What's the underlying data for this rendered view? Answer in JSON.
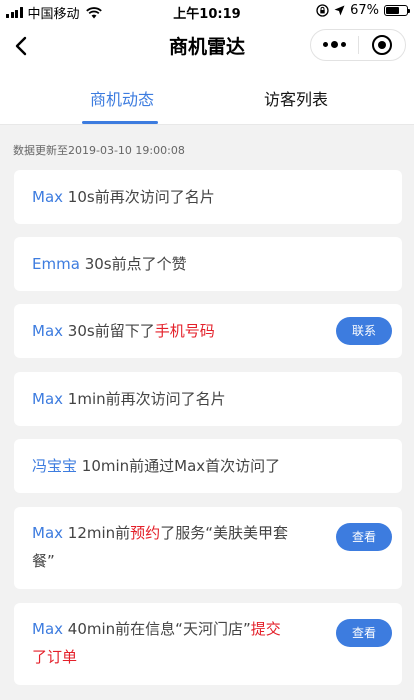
{
  "status_bar": {
    "carrier": "中国移动",
    "time": "上午10:19",
    "battery": "67%",
    "battery_level": 0.67,
    "icons": [
      "signal-icon",
      "wifi-icon",
      "lock-rotation-icon",
      "location-icon",
      "battery-icon"
    ]
  },
  "nav": {
    "title": "商机雷达",
    "back_icon": "chevron-left-icon",
    "more_icon": "more-dots-icon",
    "close_icon": "target-icon"
  },
  "tabs": [
    {
      "label": "商机动态",
      "active": true
    },
    {
      "label": "访客列表",
      "active": false
    }
  ],
  "update_text": "数据更新至2019-03-10 19:00:08",
  "colors": {
    "accent": "#3d7cdf",
    "highlight": "#e4202a",
    "background": "#f2f2f2"
  },
  "feed": [
    {
      "name": "Max",
      "t1": "10s前再次访问了名片",
      "hl": "",
      "t2": "",
      "hl2": "",
      "action": ""
    },
    {
      "name": "Emma",
      "t1": "30s前点了个赞",
      "hl": "",
      "t2": "",
      "hl2": "",
      "action": ""
    },
    {
      "name": "Max",
      "t1": "30s前留下了",
      "hl": "手机号码",
      "t2": "",
      "hl2": "",
      "action": "联系"
    },
    {
      "name": "Max",
      "t1": "1min前再次访问了名片",
      "hl": "",
      "t2": "",
      "hl2": "",
      "action": ""
    },
    {
      "name": "冯宝宝",
      "t1": "10min前通过Max首次访问了",
      "hl": "",
      "t2": "",
      "hl2": "",
      "action": ""
    },
    {
      "name": "Max",
      "t1": "12min前",
      "hl": "预约",
      "t2": "了服务“美肤美甲套餐”",
      "hl2": "",
      "action": "查看"
    },
    {
      "name": "Max",
      "t1": "40min前在信息“天河门店”",
      "hl": "提交了订单",
      "t2": "",
      "hl2": "",
      "action": "查看"
    }
  ]
}
